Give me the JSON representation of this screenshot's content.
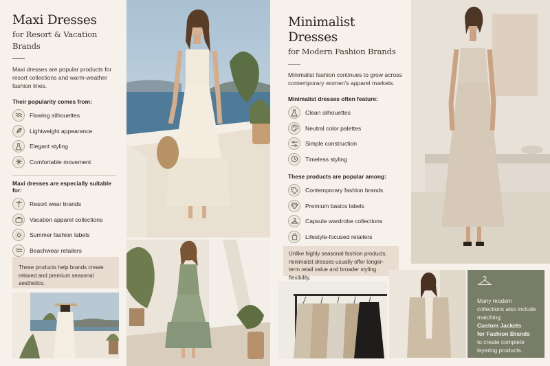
{
  "left": {
    "title": "Maxi Dresses",
    "subtitle": "for Resort & Vacation Brands",
    "intro": "Maxi dresses are popular products for resort collections and warm-weather fashion lines.",
    "popularity_heading": "Their popularity comes from:",
    "popularity_items": [
      {
        "label": "Flowing silhouettes",
        "icon": "waves-icon"
      },
      {
        "label": "Lightweight appearance",
        "icon": "feather-icon"
      },
      {
        "label": "Elegant styling",
        "icon": "dress-icon"
      },
      {
        "label": "Comfortable movement",
        "icon": "sparkle-icon"
      }
    ],
    "suitable_heading": "Maxi dresses are especially suitable for:",
    "suitable_items": [
      {
        "label": "Resort wear brands",
        "icon": "palm-icon"
      },
      {
        "label": "Vacation apparel collections",
        "icon": "suitcase-icon"
      },
      {
        "label": "Summer fashion labels",
        "icon": "sun-icon"
      },
      {
        "label": "Beachwear retailers",
        "icon": "waves-icon"
      }
    ],
    "note": "These products help brands create relaxed and premium seasonal aesthetics."
  },
  "right": {
    "title": "Minimalist Dresses",
    "subtitle": "for Modern Fashion Brands",
    "intro": "Minimalist fashion continues to grow across contemporary women's apparel markets.",
    "feature_heading": "Minimalist dresses often feature:",
    "feature_items": [
      {
        "label": "Clean silhouettes",
        "icon": "dress-icon"
      },
      {
        "label": "Neutral color palettes",
        "icon": "palette-icon"
      },
      {
        "label": "Simple construction",
        "icon": "sliders-icon"
      },
      {
        "label": "Timeless styling",
        "icon": "clock-icon"
      }
    ],
    "popular_heading": "These products are popular among:",
    "popular_items": [
      {
        "label": "Contemporary fashion brands",
        "icon": "tag-icon"
      },
      {
        "label": "Premium basics labels",
        "icon": "diamond-icon"
      },
      {
        "label": "Capsule wardrobe collections",
        "icon": "hanger-icon"
      },
      {
        "label": "Lifestyle-focused retailers",
        "icon": "bag-icon"
      }
    ],
    "note": "Unlike highly seasonal fashion products, minimalist dresses usually offer longer-term retail value and broader styling flexibility."
  },
  "promo": {
    "icon": "hanger-icon",
    "line1": "Many modern collections also include matching",
    "bold1": "Custom Jackets",
    "bold2": "for Fashion Brands",
    "line2": "to create complete layering products."
  }
}
